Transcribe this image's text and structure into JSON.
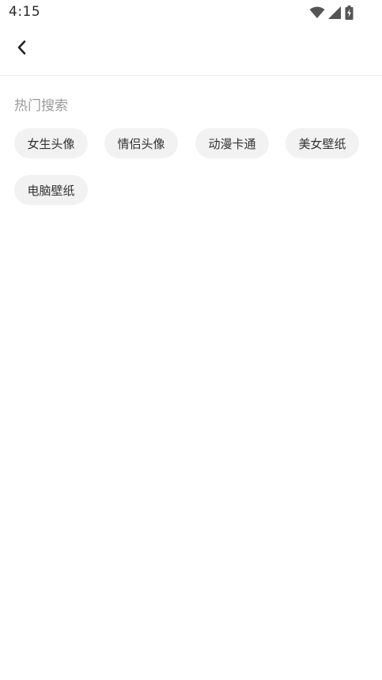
{
  "status_bar": {
    "time": "4:15",
    "icons": [
      "wifi-icon",
      "cell-signal-icon",
      "battery-charging-icon"
    ]
  },
  "top_bar": {
    "back_icon": "chevron-left-icon"
  },
  "hot_search": {
    "title": "热门搜索",
    "tags": [
      {
        "label": "女生头像"
      },
      {
        "label": "情侣头像"
      },
      {
        "label": "动漫卡通"
      },
      {
        "label": "美女壁纸"
      },
      {
        "label": "电脑壁纸"
      }
    ]
  }
}
